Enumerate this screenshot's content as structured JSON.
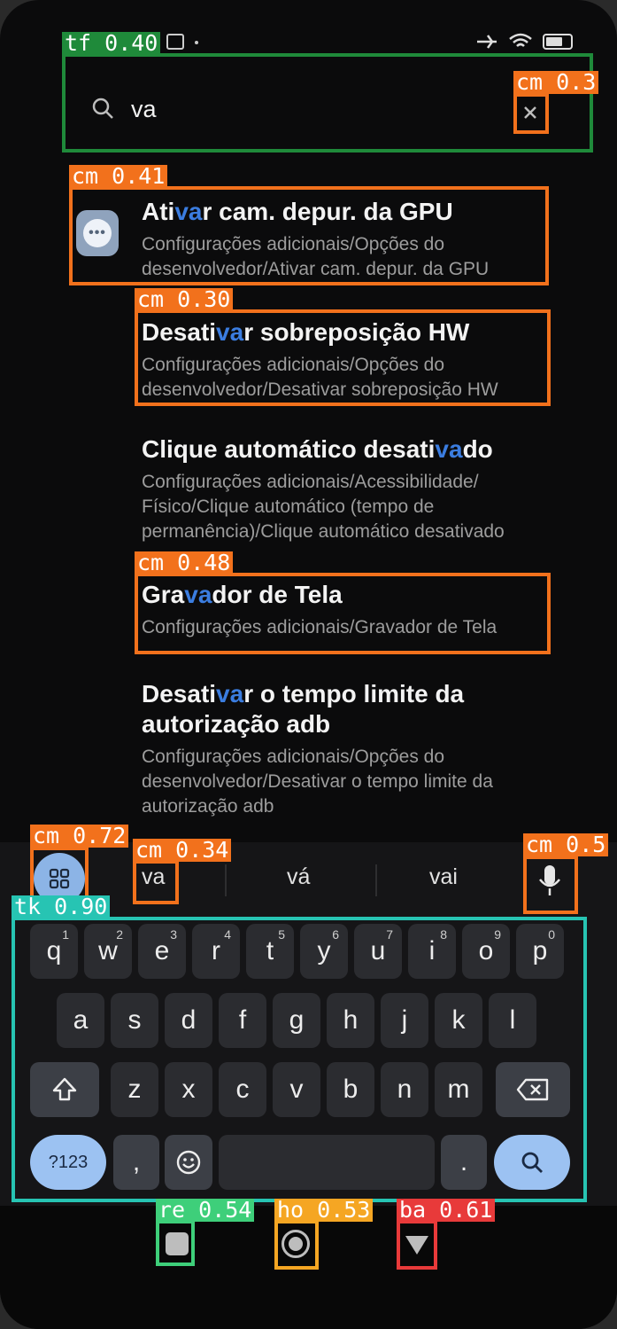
{
  "status": {
    "left_icons": "notification-icons",
    "right_icons": "battery-wifi-icons"
  },
  "search": {
    "query": "va",
    "search_icon": "search-icon",
    "clear_icon": "close-icon"
  },
  "results": [
    {
      "title_pre": "Ati",
      "title_hl": "va",
      "title_post": "r cam. depur. da GPU",
      "path": "Configurações adicionais/Opções do desenvolvedor/Ativar cam. depur. da GPU",
      "icon": "more-settings-icon"
    },
    {
      "title_pre": "Desati",
      "title_hl": "va",
      "title_post": "r sobreposição HW",
      "path": "Configurações adicionais/Opções do desenvolvedor/Desativar sobreposição HW"
    },
    {
      "title_pre": "Clique automático desati",
      "title_hl": "va",
      "title_post": "do",
      "path": "Configurações adicionais/Acessibilidade/ Físico/Clique automático (tempo de permanência)/Clique automático desativado"
    },
    {
      "title_pre": "Gra",
      "title_hl": "va",
      "title_post": "dor de Tela",
      "path": "Configurações adicionais/Gravador de Tela"
    },
    {
      "title_pre": "Desati",
      "title_hl": "va",
      "title_post": "r o tempo limite da autorização adb",
      "path": "Configurações adicionais/Opções do desenvolvedor/Desativar o tempo limite da autorização adb"
    }
  ],
  "suggestions": [
    "va",
    "vá",
    "vai"
  ],
  "keyboard": {
    "row1": [
      [
        "q",
        "1"
      ],
      [
        "w",
        "2"
      ],
      [
        "e",
        "3"
      ],
      [
        "r",
        "4"
      ],
      [
        "t",
        "5"
      ],
      [
        "y",
        "6"
      ],
      [
        "u",
        "7"
      ],
      [
        "i",
        "8"
      ],
      [
        "o",
        "9"
      ],
      [
        "p",
        "0"
      ]
    ],
    "row2": [
      "a",
      "s",
      "d",
      "f",
      "g",
      "h",
      "j",
      "k",
      "l"
    ],
    "row3": [
      "z",
      "x",
      "c",
      "v",
      "b",
      "n",
      "m"
    ],
    "symbols_label": "?123",
    "comma": ",",
    "period": "."
  },
  "overlays": [
    {
      "id": "tf",
      "label": "tf 0.40",
      "color": "#1f8a3a"
    },
    {
      "id": "cm-clear",
      "label": "cm 0.3",
      "color": "#f2711c"
    },
    {
      "id": "cm-1",
      "label": "cm 0.41",
      "color": "#f2711c"
    },
    {
      "id": "cm-2",
      "label": "cm 0.30",
      "color": "#f2711c"
    },
    {
      "id": "cm-3",
      "label": "cm 0.48",
      "color": "#f2711c"
    },
    {
      "id": "cm-apps",
      "label": "cm 0.72",
      "color": "#f2711c"
    },
    {
      "id": "cm-va",
      "label": "cm 0.34",
      "color": "#f2711c"
    },
    {
      "id": "cm-mic",
      "label": "cm 0.5",
      "color": "#f2711c"
    },
    {
      "id": "tk",
      "label": "tk 0.90",
      "color": "#27c4b3"
    },
    {
      "id": "re",
      "label": "re 0.54",
      "color": "#3ecf7a"
    },
    {
      "id": "ho",
      "label": "ho 0.53",
      "color": "#f5a623"
    },
    {
      "id": "ba",
      "label": "ba 0.61",
      "color": "#e83a3a"
    }
  ]
}
